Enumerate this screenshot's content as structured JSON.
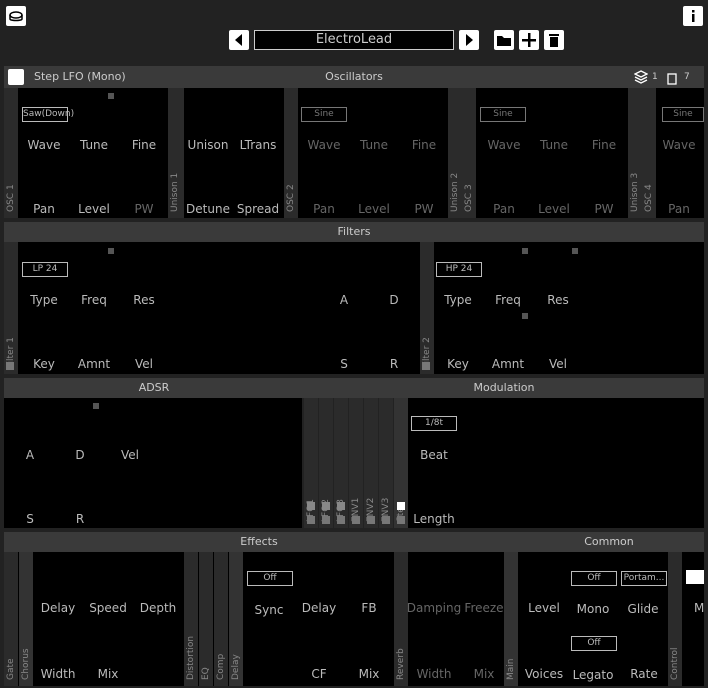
{
  "header": {
    "preset_name": "ElectroLead"
  },
  "osc_bar": {
    "step_lfo": "Step LFO (Mono)",
    "title": "Oscillators",
    "layers": "1",
    "voices": "7"
  },
  "osc": [
    {
      "tab": "OSC 1",
      "wave": "Saw(Down)",
      "labels": [
        "Wave",
        "Tune",
        "Fine",
        "Pan",
        "Level",
        "PW"
      ]
    },
    {
      "tab": "OSC 2",
      "wave": "Sine",
      "labels": [
        "Wave",
        "Tune",
        "Fine",
        "Pan",
        "Level",
        "PW"
      ]
    },
    {
      "tab": "OSC 3",
      "wave": "Sine",
      "labels": [
        "Wave",
        "Tune",
        "Fine",
        "Pan",
        "Level",
        "PW"
      ]
    },
    {
      "tab": "OSC 4",
      "wave": "Sine",
      "labels": [
        "Wave",
        "Pan"
      ]
    }
  ],
  "unison": [
    {
      "tab": "Unison 1",
      "labels": [
        "Unison",
        "LTrans",
        "Detune",
        "Spread"
      ]
    },
    {
      "tab": "Unison 2"
    },
    {
      "tab": "Unison 3"
    }
  ],
  "filters": {
    "title": "Filters",
    "f1": {
      "tab": "Filter 1",
      "type": "LP 24",
      "labels": [
        "Type",
        "Freq",
        "Res",
        "Key",
        "Amnt",
        "Vel"
      ]
    },
    "f2": {
      "tab": "Filter 2",
      "type": "HP 24",
      "labels": [
        "Type",
        "Freq",
        "Res",
        "Key",
        "Amnt",
        "Vel"
      ]
    },
    "env": [
      "A",
      "D",
      "S",
      "R"
    ]
  },
  "adsr": {
    "title": "ADSR",
    "labels": [
      "A",
      "D",
      "Vel",
      "S",
      "R"
    ]
  },
  "modulation": {
    "title": "Modulation",
    "tabs": [
      "LFO1",
      "LFO2",
      "LFO3",
      "ENV1",
      "ENV2",
      "ENV3",
      "Step"
    ],
    "beat": "1/8t",
    "labels": [
      "Beat",
      "Length"
    ]
  },
  "effects": {
    "title": "Effects",
    "tabs": {
      "gate": "Gate",
      "chorus": "Chorus",
      "distortion": "Distortion",
      "eq": "EQ",
      "comp": "Comp",
      "delay": "Delay",
      "reverb": "Reverb"
    },
    "chorus_labels": [
      "Delay",
      "Speed",
      "Depth",
      "Width",
      "Mix"
    ],
    "sync_value": "Off",
    "delay_labels": [
      "Sync",
      "Delay",
      "FB",
      "CF",
      "Mix"
    ],
    "reverb_labels": [
      "Damping",
      "Freeze",
      "Width",
      "Mix"
    ]
  },
  "common": {
    "title": "Common",
    "main_tab": "Main",
    "control_tab": "Control",
    "mono_value": "Off",
    "glide_value": "Portam...",
    "legato_value": "Off",
    "labels": [
      "Level",
      "Mono",
      "Glide",
      "Voices",
      "Legato",
      "Rate"
    ],
    "cut_label": "M"
  }
}
